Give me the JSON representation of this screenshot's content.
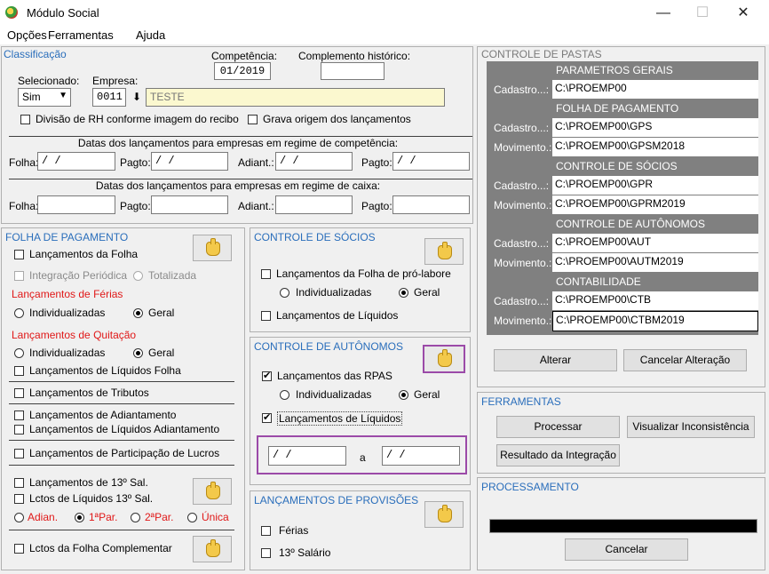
{
  "window": {
    "title": "Módulo Social",
    "minimize": "—",
    "maximize": "☐",
    "close": "✕"
  },
  "menu": [
    "Opções",
    "Ferramentas",
    "Ajuda"
  ],
  "classificacao": {
    "title": "Classificação",
    "competencia_label": "Competência:",
    "competencia_value": "01/2019",
    "complemento_label": "Complemento histórico:",
    "complemento_value": "",
    "selecionado_label": "Selecionado:",
    "selecionado_value": "Sim",
    "empresa_label": "Empresa:",
    "empresa_code": "0011",
    "empresa_name": "TESTE",
    "divisao_label": "Divisão de RH conforme imagem do recibo",
    "grava_label": "Grava origem dos lançamentos",
    "competencia_section": "Datas dos lançamentos para empresas em regime de competência:",
    "caixa_section": "Datas dos lançamentos para empresas em regime de caixa:",
    "folha_label": "Folha:",
    "pagto_label": "Pagto:",
    "adiant_label": "Adiant.:",
    "date_placeholder": " / /"
  },
  "folha": {
    "title": "FOLHA DE PAGAMENTO",
    "lanc_folha": "Lançamentos da Folha",
    "integracao": "Integração Periódica",
    "totalizada": "Totalizada",
    "ferias_title": "Lançamentos de Férias",
    "individualizadas": "Individualizadas",
    "geral": "Geral",
    "quitacao_title": "Lançamentos de Quitação",
    "liq_folha": "Lançamentos de Líquidos Folha",
    "tributos": "Lançamentos de Tributos",
    "adiantamento": "Lançamentos de Adiantamento",
    "liq_adiantamento": "Lançamentos de Líquidos Adiantamento",
    "participacao": "Lançamentos de Participação de Lucros",
    "decimo": "Lançamentos de 13º Sal.",
    "liq_decimo": "Lctos de Líquidos 13º Sal.",
    "adian": "Adian.",
    "primeira": "1ªPar.",
    "segunda": "2ªPar.",
    "unica": "Única",
    "complementar": "Lctos da Folha Complementar"
  },
  "socios": {
    "title": "CONTROLE DE SÓCIOS",
    "pro_labore": "Lançamentos da Folha de pró-labore",
    "individualizadas": "Individualizadas",
    "geral": "Geral",
    "liquidos": "Lançamentos de Líquidos"
  },
  "autonomos": {
    "title": "CONTROLE DE AUTÔNOMOS",
    "rpas": "Lançamentos das RPAS",
    "individualizadas": "Individualizadas",
    "geral": "Geral",
    "liquidos": "Lançamentos de Líquidos",
    "date_from": " / /",
    "a_label": "a",
    "date_to": " / /"
  },
  "provisoes": {
    "title": "LANÇAMENTOS DE PROVISÕES",
    "ferias": "Férias",
    "decimo": "13º Salário"
  },
  "pastas": {
    "title": "CONTROLE DE PASTAS",
    "groups": [
      {
        "name": "PARAMETROS GERAIS",
        "rows": [
          {
            "label": "Cadastro...:",
            "path": "C:\\PROEMP00"
          }
        ]
      },
      {
        "name": "FOLHA DE PAGAMENTO",
        "rows": [
          {
            "label": "Cadastro...:",
            "path": "C:\\PROEMP00\\GPS"
          },
          {
            "label": "Movimento.:",
            "path": "C:\\PROEMP00\\GPSM2018"
          }
        ]
      },
      {
        "name": "CONTROLE DE SÓCIOS",
        "rows": [
          {
            "label": "Cadastro...:",
            "path": "C:\\PROEMP00\\GPR"
          },
          {
            "label": "Movimento.:",
            "path": "C:\\PROEMP00\\GPRM2019"
          }
        ]
      },
      {
        "name": "CONTROLE DE AUTÔNOMOS",
        "rows": [
          {
            "label": "Cadastro...:",
            "path": "C:\\PROEMP00\\AUT"
          },
          {
            "label": "Movimento.:",
            "path": "C:\\PROEMP00\\AUTM2019"
          }
        ]
      },
      {
        "name": "CONTABILIDADE",
        "rows": [
          {
            "label": "Cadastro...:",
            "path": "C:\\PROEMP00\\CTB"
          },
          {
            "label": "Movimento.:",
            "path": "C:\\PROEMP00\\CTBM2019"
          }
        ]
      }
    ],
    "alterar": "Alterar",
    "cancelar_alteracao": "Cancelar Alteração"
  },
  "ferramentas": {
    "title": "FERRAMENTAS",
    "processar": "Processar",
    "visualizar": "Visualizar Inconsistência",
    "resultado": "Resultado da Integração"
  },
  "processamento": {
    "title": "PROCESSAMENTO",
    "cancelar": "Cancelar",
    "progress": 1.0
  }
}
